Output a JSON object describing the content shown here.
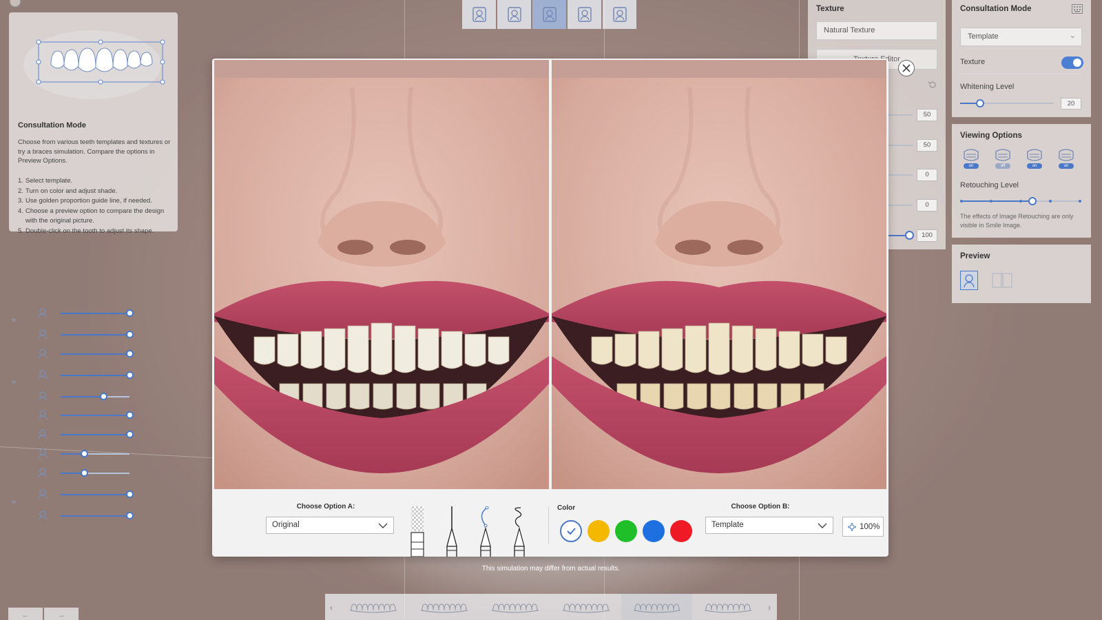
{
  "guide": {
    "title": "Consultation Mode",
    "description": "Choose from various teeth templates and textures or try a braces simulation. Compare the options in Preview Options.",
    "steps": [
      {
        "n": "1.",
        "text": "Select template."
      },
      {
        "n": "2.",
        "text": "Turn on color and adjust shade."
      },
      {
        "n": "3.",
        "text": "Use golden proportion guide line, if needed."
      },
      {
        "n": "4.",
        "text": "Choose a preview option to compare the design with the original picture."
      },
      {
        "n": "5.",
        "text": "Double-click on the tooth to adjust its shape."
      }
    ]
  },
  "left_sliders": [
    {
      "icon": "face-user-icon",
      "value": 1.0
    },
    {
      "icon": "face-head-icon",
      "value": 1.0
    },
    {
      "icon": "face-smile-icon",
      "value": 1.0
    },
    {
      "icon": "teeth-arch-icon",
      "value": 1.0
    },
    {
      "icon": "tooth-axis-icon",
      "value": 0.62
    },
    {
      "icon": "teeth-line-icon",
      "value": 1.0
    },
    {
      "icon": "lip-line-icon",
      "value": 1.0
    },
    {
      "icon": "teeth-spacing-icon",
      "value": 0.34
    },
    {
      "icon": "tooth-position-icon",
      "value": 0.34
    },
    {
      "icon": "teeth-full-icon",
      "value": 1.0
    },
    {
      "icon": "teeth-small-icon",
      "value": 1.0
    }
  ],
  "top_toolbar": [
    {
      "icon": "photo-face-icon",
      "active": false
    },
    {
      "icon": "alignment-icon",
      "active": false
    },
    {
      "icon": "consultation-icon",
      "active": true
    },
    {
      "icon": "teeth-design-icon",
      "active": false
    },
    {
      "icon": "checklist-icon",
      "active": false
    }
  ],
  "texture_panel": {
    "title": "Texture",
    "select_value": "Natural Texture",
    "editor_button": "Texture Editor",
    "values": [
      "50",
      "50",
      "0",
      "0",
      "100"
    ]
  },
  "consultation_panel": {
    "title": "Consultation Mode",
    "template_value": "Template",
    "texture_label": "Texture",
    "texture_on": true,
    "whitening_label": "Whitening Level",
    "whitening_value": "20"
  },
  "viewing_panel": {
    "title": "Viewing Options",
    "options": [
      {
        "icon": "view-face-icon",
        "state": "on"
      },
      {
        "icon": "view-braces-icon",
        "state": "off"
      },
      {
        "icon": "view-teeth-icon",
        "state": "on"
      },
      {
        "icon": "view-retouch-icon",
        "state": "on"
      }
    ],
    "retouching_label": "Retouching Level",
    "retouching_value": 0.6,
    "note": "The effects of Image Retouching are only visible in Smile Image."
  },
  "preview_panel": {
    "title": "Preview"
  },
  "modal": {
    "option_a_label": "Choose Option A:",
    "option_a_value": "Original",
    "option_b_label": "Choose Option B:",
    "option_b_value": "Template",
    "color_label": "Color",
    "colors": [
      "#ffffff",
      "#f5b800",
      "#1fbf2a",
      "#1e6fe0",
      "#ee1b26"
    ],
    "zoom": "100%"
  },
  "disclaimer": "This simulation may differ from actual results."
}
